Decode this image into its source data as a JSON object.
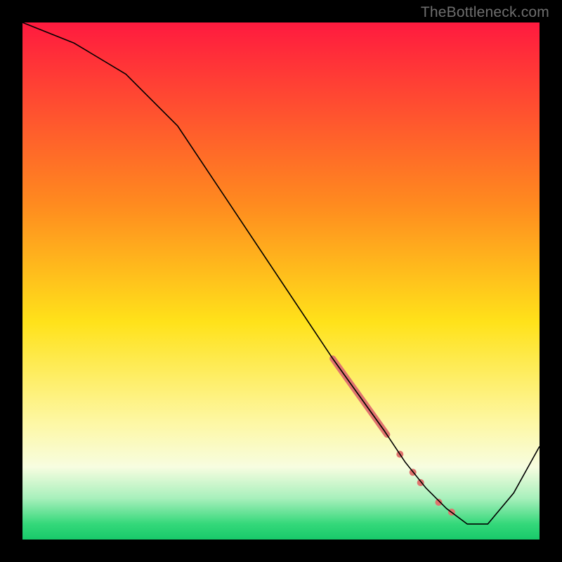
{
  "watermark": "TheBottleneck.com",
  "chart_data": {
    "type": "line",
    "title": "",
    "xlabel": "",
    "ylabel": "",
    "xlim": [
      0,
      100
    ],
    "ylim": [
      0,
      100
    ],
    "grid": false,
    "legend": false,
    "gradient_stops": [
      {
        "offset": 0.0,
        "color": "#ff1a3f"
      },
      {
        "offset": 0.35,
        "color": "#ff8a1f"
      },
      {
        "offset": 0.58,
        "color": "#ffe21a"
      },
      {
        "offset": 0.78,
        "color": "#fdf8a8"
      },
      {
        "offset": 0.86,
        "color": "#f7fde0"
      },
      {
        "offset": 0.92,
        "color": "#a8f0bc"
      },
      {
        "offset": 0.97,
        "color": "#34d87a"
      },
      {
        "offset": 1.0,
        "color": "#18c96a"
      }
    ],
    "series": [
      {
        "name": "bottleneck-curve",
        "stroke": "#000000",
        "stroke_width": 1.6,
        "x": [
          0,
          10,
          20,
          30,
          40,
          50,
          60,
          65,
          70,
          74,
          78,
          82,
          86,
          90,
          95,
          100
        ],
        "values": [
          100,
          96,
          90,
          80,
          65,
          50,
          35,
          28,
          21,
          15,
          10,
          6,
          3,
          3,
          9,
          18
        ]
      }
    ],
    "highlight_segment": {
      "name": "dense-region",
      "color": "#e0746e",
      "stroke_width": 9,
      "linecap": "round",
      "x": [
        60,
        70.5
      ],
      "values": [
        35,
        20.3
      ]
    },
    "scatter": {
      "name": "outlier-points",
      "color": "#e0746e",
      "radius": 5,
      "points": [
        {
          "x": 73.0,
          "y": 16.5
        },
        {
          "x": 75.5,
          "y": 13.0
        },
        {
          "x": 77.0,
          "y": 11.0
        },
        {
          "x": 80.5,
          "y": 7.2
        },
        {
          "x": 83.0,
          "y": 5.3
        }
      ]
    }
  }
}
